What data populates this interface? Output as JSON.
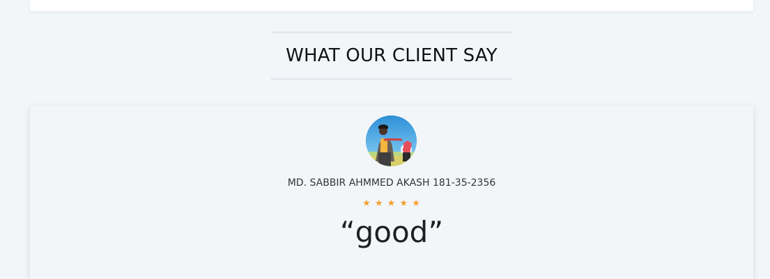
{
  "section": {
    "title": "WHAT OUR CLIENT SAY"
  },
  "testimonial": {
    "name": "MD. SABBIR AHMMED AKASH 181-35-2356",
    "rating": 5,
    "rating_max": 5,
    "stars": [
      "★",
      "★",
      "★",
      "★",
      "★"
    ],
    "quote": "“good”"
  },
  "colors": {
    "background": "#f3f6f9",
    "star": "#f3a02d",
    "divider": "#e4e8ee"
  },
  "icons": {
    "star": "star-icon",
    "avatar": "client-avatar"
  }
}
